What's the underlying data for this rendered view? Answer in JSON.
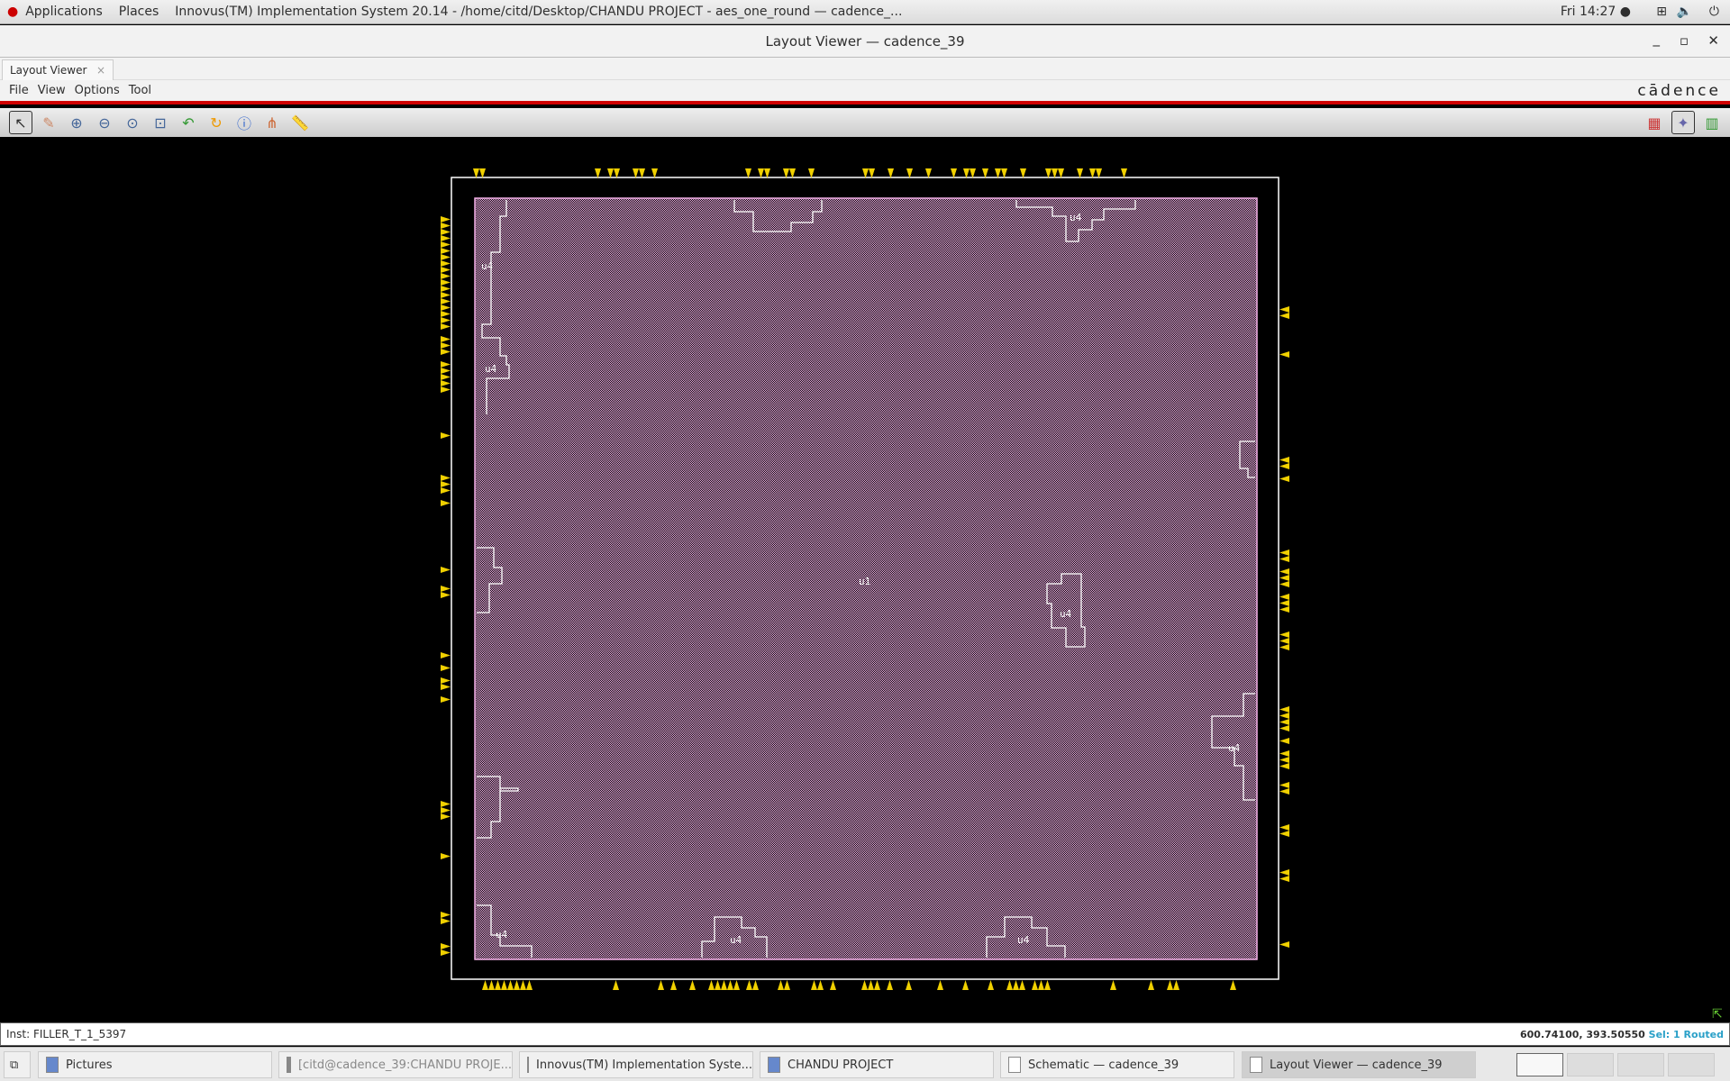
{
  "topbar": {
    "applications": "Applications",
    "places": "Places",
    "window_title": "Innovus(TM) Implementation System 20.14 - /home/citd/Desktop/CHANDU PROJECT - aes_one_round — cadence_...",
    "clock": "Fri 14:27 ●"
  },
  "window": {
    "title": "Layout Viewer — cadence_39",
    "minimize": "_",
    "maximize": "▫",
    "close": "✕"
  },
  "tab": {
    "label": "Layout Viewer",
    "close": "×"
  },
  "menu": [
    "File",
    "View",
    "Options",
    "Tool"
  ],
  "logo": "cādence",
  "layout": {
    "core_label": "u1",
    "module_label": "u4",
    "pin_color": "#f0d000",
    "core_color": "#f4b0e8",
    "outline_color": "#ffffff"
  },
  "status": {
    "inst": "Inst: FILLER_T_1_5397",
    "coords": "600.74100, 393.50550",
    "sel": "Sel: 1",
    "routed": "Routed"
  },
  "taskbar": [
    {
      "label": "Pictures"
    },
    {
      "label": "[citd@cadence_39:CHANDU PROJE..."
    },
    {
      "label": "Innovus(TM) Implementation Syste..."
    },
    {
      "label": "CHANDU PROJECT"
    },
    {
      "label": "Schematic — cadence_39"
    },
    {
      "label": "Layout Viewer — cadence_39",
      "active": true
    }
  ]
}
